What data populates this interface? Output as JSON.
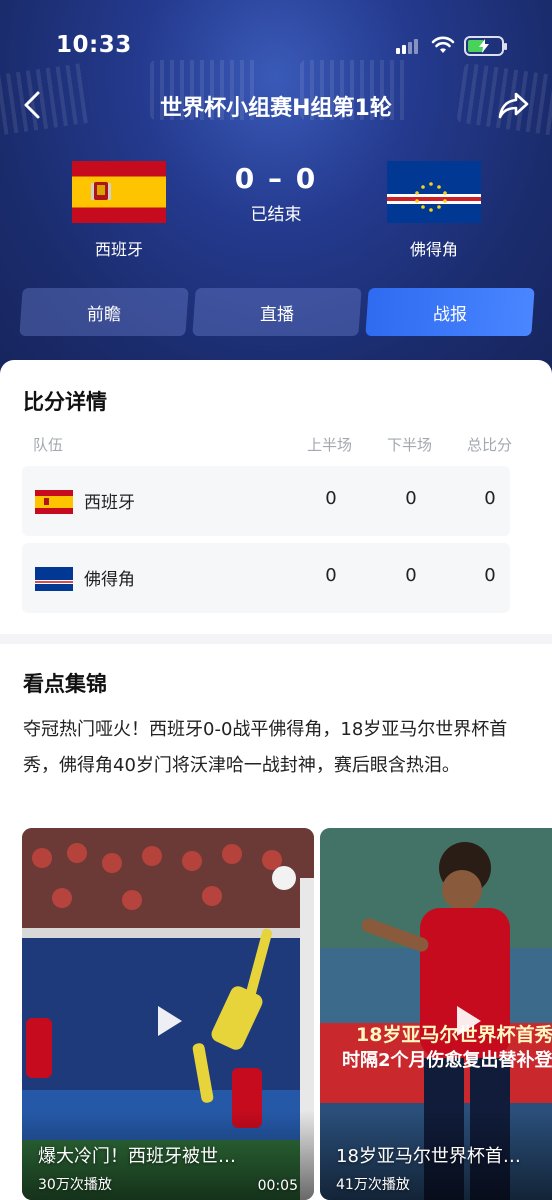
{
  "status_bar": {
    "time": "10:33"
  },
  "nav": {
    "title": "世界杯小组赛H组第1轮",
    "back_icon": "chevron-left-icon",
    "share_icon": "share-icon"
  },
  "match": {
    "home_team": "西班牙",
    "away_team": "佛得角",
    "score": "0 – 0",
    "status": "已结束"
  },
  "tabs": [
    {
      "label": "前瞻",
      "active": false
    },
    {
      "label": "直播",
      "active": false
    },
    {
      "label": "战报",
      "active": true
    }
  ],
  "score_detail": {
    "title": "比分详情",
    "headers": [
      "队伍",
      "上半场",
      "下半场",
      "总比分"
    ],
    "rows": [
      {
        "team": "西班牙",
        "first_half": "0",
        "second_half": "0",
        "total": "0"
      },
      {
        "team": "佛得角",
        "first_half": "0",
        "second_half": "0",
        "total": "0"
      }
    ]
  },
  "highlights": {
    "title": "看点集锦",
    "summary": "夺冠热门哑火！西班牙0-0战平佛得角，18岁亚马尔世界杯首秀，佛得角40岁门将沃津哈一战封神，赛后眼含热泪。",
    "videos": [
      {
        "title": "爆大冷门！西班牙被世…",
        "views": "30万次播放",
        "duration": "00:05"
      },
      {
        "title": "18岁亚马尔世界杯首…",
        "views": "41万次播放",
        "duration": "",
        "banner_line1": "18岁亚马尔世界杯首秀",
        "banner_line2": "时隔2个月伤愈复出替补登"
      }
    ]
  },
  "colors": {
    "accent": "#3a7cf6",
    "header_bg": "#1f3480",
    "spain_red": "#c60b1e",
    "spain_yellow": "#ffc400",
    "cv_blue": "#003893"
  }
}
